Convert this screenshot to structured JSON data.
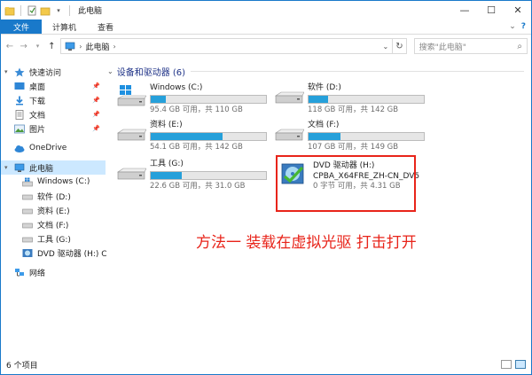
{
  "window": {
    "title": "此电脑",
    "controls": {
      "minimize": "—",
      "maximize": "☐",
      "close": "✕"
    }
  },
  "ribbon": {
    "tabs": [
      "文件",
      "计算机",
      "查看"
    ],
    "help": "?"
  },
  "address": {
    "path_label": "此电脑",
    "search_placeholder": "搜索\"此电脑\""
  },
  "nav": {
    "quick_access": "快速访问",
    "quick_items": [
      {
        "label": "桌面",
        "icon": "desktop-icon"
      },
      {
        "label": "下载",
        "icon": "download-icon"
      },
      {
        "label": "文档",
        "icon": "documents-icon"
      },
      {
        "label": "图片",
        "icon": "pictures-icon"
      }
    ],
    "onedrive": "OneDrive",
    "this_pc": "此电脑",
    "drives": [
      "Windows (C:)",
      "软件 (D:)",
      "资料 (E:)",
      "文档 (F:)",
      "工具 (G:)",
      "DVD 驱动器 (H:) C"
    ],
    "network": "网络"
  },
  "content": {
    "group_header": "设备和驱动器 (6)",
    "drives": [
      {
        "name": "Windows (C:)",
        "free": "95.4 GB 可用，共 110 GB",
        "used_fraction": 0.13
      },
      {
        "name": "软件 (D:)",
        "free": "118 GB 可用，共 142 GB",
        "used_fraction": 0.17
      },
      {
        "name": "资料 (E:)",
        "free": "54.1 GB 可用，共 142 GB",
        "used_fraction": 0.62
      },
      {
        "name": "文档 (F:)",
        "free": "107 GB 可用，共 149 GB",
        "used_fraction": 0.28
      },
      {
        "name": "工具 (G:)",
        "free": "22.6 GB 可用，共 31.0 GB",
        "used_fraction": 0.27
      }
    ],
    "dvd": {
      "name": "DVD 驱动器 (H:)",
      "label": "CPBA_X64FRE_ZH-CN_DV5",
      "free": "0 字节 可用，共 4.31 GB"
    },
    "annotation": "方法一 装载在虚拟光驱 打击打开"
  },
  "status": {
    "count": "6 个项目"
  },
  "colors": {
    "accent": "#1979ca",
    "bar": "#26a0da",
    "annotation": "#e8241a",
    "selected": "#cce8ff"
  }
}
